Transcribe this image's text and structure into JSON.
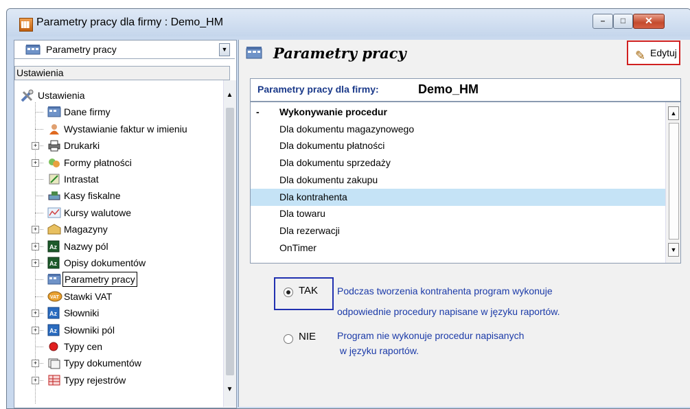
{
  "window": {
    "title": "Parametry pracy dla firmy : Demo_HM",
    "controls": {
      "minimize": "–",
      "maximize": "□",
      "close": "✕"
    }
  },
  "left": {
    "combo_value": "Parametry pracy",
    "section_header": "Ustawienia",
    "tree": [
      {
        "label": "Ustawienia",
        "icon": "tools-icon",
        "level": 0,
        "expander": ""
      },
      {
        "label": "Dane firmy",
        "icon": "building-icon",
        "level": 1,
        "expander": ""
      },
      {
        "label": "Wystawianie faktur w imieniu",
        "icon": "person-icon",
        "level": 1,
        "expander": ""
      },
      {
        "label": "Drukarki",
        "icon": "printer-icon",
        "level": 1,
        "expander": "+"
      },
      {
        "label": "Formy płatności",
        "icon": "money-icon",
        "level": 1,
        "expander": "+"
      },
      {
        "label": "Intrastat",
        "icon": "intrastat-icon",
        "level": 1,
        "expander": ""
      },
      {
        "label": "Kasy fiskalne",
        "icon": "cash-register-icon",
        "level": 1,
        "expander": ""
      },
      {
        "label": "Kursy walutowe",
        "icon": "chart-icon",
        "level": 1,
        "expander": ""
      },
      {
        "label": "Magazyny",
        "icon": "warehouse-icon",
        "level": 1,
        "expander": "+"
      },
      {
        "label": "Nazwy pól",
        "icon": "az-icon",
        "level": 1,
        "expander": "+"
      },
      {
        "label": "Opisy dokumentów",
        "icon": "az-icon",
        "level": 1,
        "expander": "+"
      },
      {
        "label": "Parametry pracy",
        "icon": "building-icon",
        "level": 1,
        "expander": "",
        "selected": true
      },
      {
        "label": "Stawki VAT",
        "icon": "vat-icon",
        "level": 1,
        "expander": ""
      },
      {
        "label": "Słowniki",
        "icon": "az-blue-icon",
        "level": 1,
        "expander": "+"
      },
      {
        "label": "Słowniki pól",
        "icon": "az-blue-icon",
        "level": 1,
        "expander": "+"
      },
      {
        "label": "Typy cen",
        "icon": "red-dot-icon",
        "level": 1,
        "expander": ""
      },
      {
        "label": "Typy dokumentów",
        "icon": "document-icon",
        "level": 1,
        "expander": "+"
      },
      {
        "label": "Typy rejestrów",
        "icon": "register-icon",
        "level": 1,
        "expander": "+"
      }
    ]
  },
  "right": {
    "title": "Parametry pracy",
    "edit_label": "Edytuj",
    "firm_label": "Parametry pracy dla firmy:",
    "firm_name": "Demo_HM",
    "list": [
      {
        "label": "Wykonywanie procedur",
        "group": true,
        "prefix": "-"
      },
      {
        "label": "Dla dokumentu magazynowego"
      },
      {
        "label": "Dla dokumentu płatności"
      },
      {
        "label": "Dla dokumentu sprzedaży"
      },
      {
        "label": "Dla dokumentu zakupu"
      },
      {
        "label": "Dla kontrahenta",
        "selected": true
      },
      {
        "label": "Dla towaru"
      },
      {
        "label": "Dla rezerwacji"
      },
      {
        "label": "OnTimer"
      }
    ],
    "option_yes": {
      "label": "TAK",
      "desc_line1": "Podczas tworzenia kontrahenta program wykonuje",
      "desc_line2": "odpowiednie procedury napisane w języku raportów."
    },
    "option_no": {
      "label": "NIE",
      "desc_line1": "Program nie wykonuje procedur napisanych",
      "desc_line2": " w języku raportów."
    },
    "selected_option": "TAK"
  }
}
